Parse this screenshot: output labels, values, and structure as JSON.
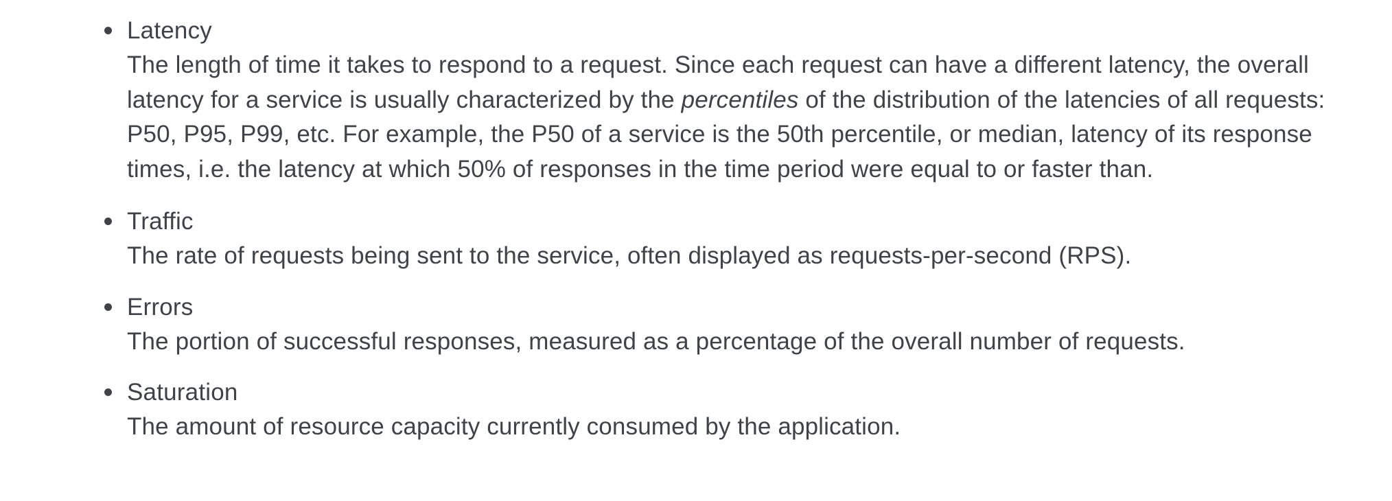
{
  "metrics": [
    {
      "term": "Latency",
      "desc_part1": "The length of time it takes to respond to a request. Since each request can have a different latency, the overall latency for a service is usually characterized by the ",
      "desc_emphasis": "percentiles",
      "desc_part2": " of the distribution of the latencies of all requests: P50, P95, P99, etc. For example, the P50 of a service is the 50th percentile, or median, latency of its response times, i.e. the latency at which 50% of responses in the time period were equal to or faster than."
    },
    {
      "term": "Traffic",
      "desc": "The rate of requests being sent to the service, often displayed as requests-per-second (RPS)."
    },
    {
      "term": "Errors",
      "desc": "The portion of successful responses, measured as a percentage of the overall number of requests."
    },
    {
      "term": "Saturation",
      "desc": "The amount of resource capacity currently consumed by the application."
    }
  ]
}
